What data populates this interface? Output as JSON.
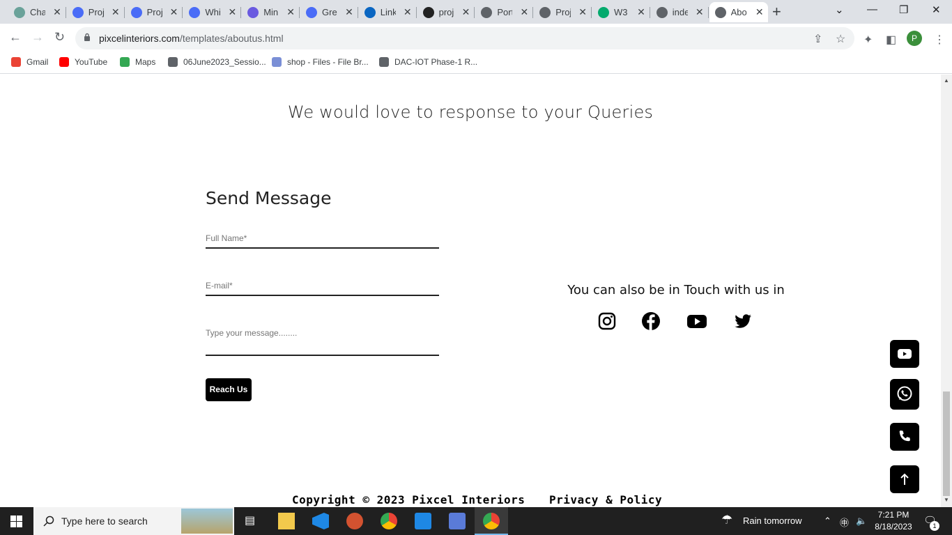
{
  "browser": {
    "tabs": [
      {
        "label": "Cha",
        "color": "#6aa29a"
      },
      {
        "label": "Proj",
        "color": "#4a6cf7"
      },
      {
        "label": "Proj",
        "color": "#4a6cf7"
      },
      {
        "label": "Whi",
        "color": "#4a6cf7"
      },
      {
        "label": "Min",
        "color": "#6a5ae0"
      },
      {
        "label": "Gre",
        "color": "#4a6cf7"
      },
      {
        "label": "Link",
        "color": "#0a66c2"
      },
      {
        "label": "proj",
        "color": "#222222"
      },
      {
        "label": "Port",
        "color": "#5f6368"
      },
      {
        "label": "Proj",
        "color": "#5f6368"
      },
      {
        "label": "W3",
        "color": "#04aa6d"
      },
      {
        "label": "inde",
        "color": "#5f6368"
      },
      {
        "label": "Abo",
        "color": "#5f6368"
      }
    ],
    "url_domain": "pixcelinteriors.com",
    "url_path": "/templates/aboutus.html",
    "profile_initial": "P",
    "bookmarks": [
      {
        "label": "Gmail",
        "color": "#ea4335"
      },
      {
        "label": "YouTube",
        "color": "#ff0000"
      },
      {
        "label": "Maps",
        "color": "#34a853"
      },
      {
        "label": "06June2023_Sessio...",
        "color": "#5f6368"
      },
      {
        "label": "shop - Files - File Br...",
        "color": "#7a8fd6"
      },
      {
        "label": "DAC-IOT Phase-1 R...",
        "color": "#5f6368"
      }
    ]
  },
  "page": {
    "headline": "We would love to response to your Queries",
    "form": {
      "title": "Send Message",
      "name_placeholder": "Full Name*",
      "email_placeholder": "E-mail*",
      "message_placeholder": "Type your message........",
      "submit_label": "Reach Us"
    },
    "touch_title": "You can also be in Touch with us in",
    "social_icons": [
      "instagram-icon",
      "facebook-icon",
      "youtube-icon",
      "twitter-icon"
    ],
    "floating_buttons": [
      "youtube-icon",
      "whatsapp-icon",
      "phone-icon",
      "arrow-up-icon"
    ],
    "footer": {
      "copyright": "Copyright © 2023 Pixcel Interiors",
      "privacy": "Privacy & Policy"
    }
  },
  "taskbar": {
    "search_placeholder": "Type here to search",
    "weather": "Rain tomorrow",
    "time": "7:21 PM",
    "date": "8/18/2023",
    "notifications": "1"
  }
}
